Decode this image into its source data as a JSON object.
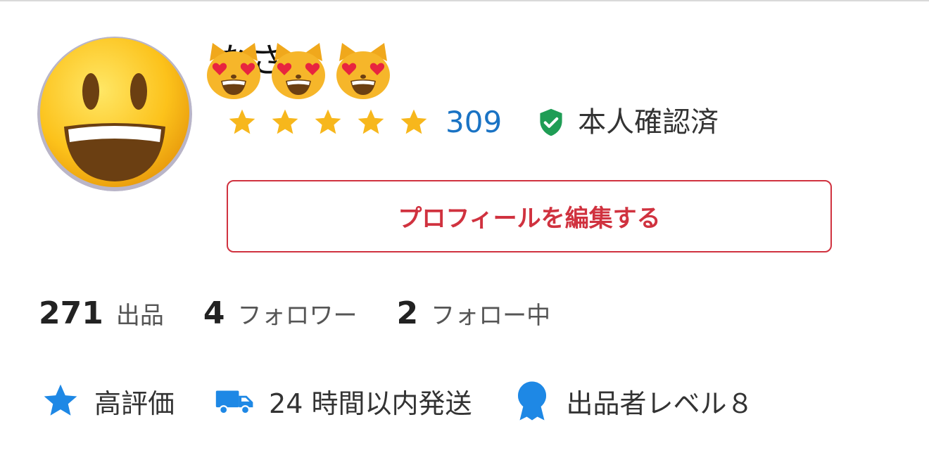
{
  "profile": {
    "avatar_icon": "grinning-face-emoji",
    "name_visible_fragment": "なさ",
    "name_emojis": [
      "smiling-cat-heart-eyes-emoji",
      "smiling-cat-heart-eyes-emoji",
      "smiling-cat-heart-eyes-emoji"
    ],
    "rating": {
      "stars": 5,
      "max_stars": 5,
      "count": "309",
      "star_color": "#f7b71c",
      "count_color": "#1a73c4"
    },
    "verified": {
      "icon": "shield-check-icon",
      "label": "本人確認済",
      "icon_color": "#1f9d55"
    },
    "edit_button_label": "プロフィールを編集する",
    "accent_color": "#d0323f"
  },
  "stats": [
    {
      "value": "271",
      "label": "出品"
    },
    {
      "value": "4",
      "label": "フォロワー"
    },
    {
      "value": "2",
      "label": "フォロー中"
    }
  ],
  "badges": [
    {
      "icon": "star-icon",
      "label": "高評価"
    },
    {
      "icon": "truck-icon",
      "label": "24 時間以内発送"
    },
    {
      "icon": "medal-icon",
      "label": "出品者レベル８"
    }
  ],
  "badge_icon_color": "#1e88e5"
}
